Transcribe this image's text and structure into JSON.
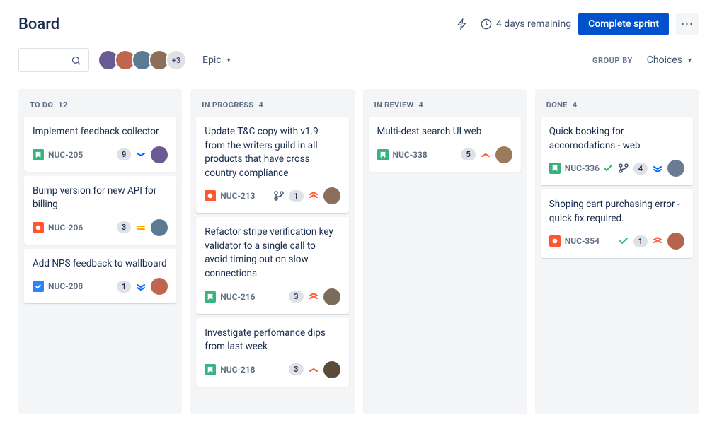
{
  "header": {
    "title": "Board",
    "remaining": "4 days remaining",
    "complete_label": "Complete sprint"
  },
  "toolbar": {
    "avatars_extra": "+3",
    "epic_label": "Epic",
    "group_by_label": "GROUP BY",
    "group_by_value": "Choices"
  },
  "columns": [
    {
      "title": "TO DO",
      "count": "12",
      "cards": [
        {
          "title": "Implement feedback collector",
          "type": "story",
          "key": "NUC-205",
          "sp": "9",
          "priority": "low",
          "avatar": "#6B5B95",
          "done": false,
          "branch": false
        },
        {
          "title": "Bump version for new API for billing",
          "type": "bug",
          "key": "NUC-206",
          "sp": "3",
          "priority": "medium",
          "avatar": "#5B7B95",
          "done": false,
          "branch": false
        },
        {
          "title": "Add NPS feedback to wallboard",
          "type": "task",
          "key": "NUC-208",
          "sp": "1",
          "priority": "lowest",
          "avatar": "#C0654E",
          "done": false,
          "branch": false
        }
      ]
    },
    {
      "title": "IN PROGRESS",
      "count": "4",
      "cards": [
        {
          "title": "Update T&C copy with v1.9 from the writers guild in all products that have cross country compliance",
          "type": "bug",
          "key": "NUC-213",
          "sp": "1",
          "priority": "highest",
          "avatar": "#8B6F5B",
          "done": false,
          "branch": true
        },
        {
          "title": "Refactor stripe verification key validator to a single call to avoid timing out on slow connections",
          "type": "story",
          "key": "NUC-216",
          "sp": "3",
          "priority": "highest",
          "avatar": "#7B6B5B",
          "done": false,
          "branch": false
        },
        {
          "title": "Investigate perfomance dips from last week",
          "type": "story",
          "key": "NUC-218",
          "sp": "3",
          "priority": "high",
          "avatar": "#5B4B3B",
          "done": false,
          "branch": false
        }
      ]
    },
    {
      "title": "IN REVIEW",
      "count": "4",
      "cards": [
        {
          "title": "Multi-dest search UI web",
          "type": "story",
          "key": "NUC-338",
          "sp": "5",
          "priority": "high",
          "avatar": "#9B7B5B",
          "done": false,
          "branch": false
        }
      ]
    },
    {
      "title": "DONE",
      "count": "4",
      "cards": [
        {
          "title": "Quick booking for accomodations - web",
          "type": "story",
          "key": "NUC-336",
          "sp": "4",
          "priority": "lowest",
          "avatar": "#6B7B95",
          "done": true,
          "branch": true
        },
        {
          "title": "Shoping cart purchasing error - quick fix required.",
          "type": "bug",
          "key": "NUC-354",
          "sp": "1",
          "priority": "highest",
          "avatar": "#B5654E",
          "done": true,
          "branch": false
        }
      ]
    }
  ],
  "avatarColors": [
    "#6B5B95",
    "#C0654E",
    "#5B7B95",
    "#8B6F5B"
  ]
}
